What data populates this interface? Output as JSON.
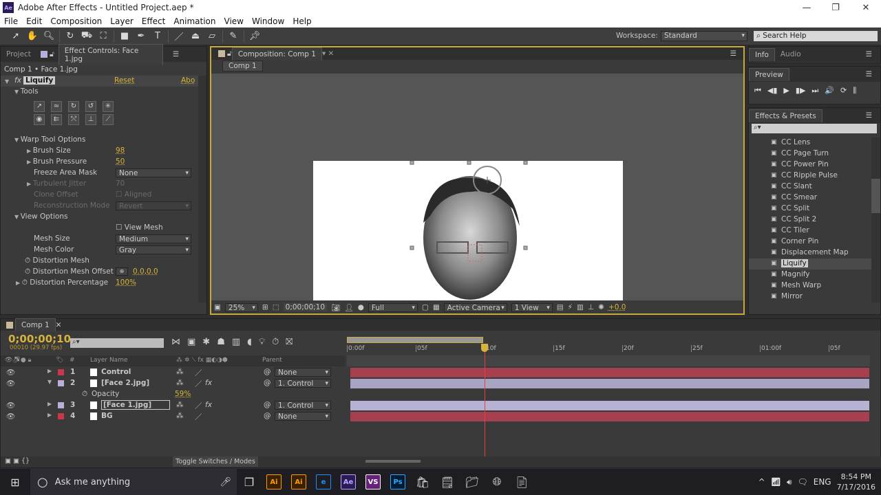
{
  "window": {
    "title": "Adobe After Effects - Untitled Project.aep *",
    "app_icon": "Ae",
    "minimize": "—",
    "restore": "❐",
    "close": "✕"
  },
  "menu": [
    "File",
    "Edit",
    "Composition",
    "Layer",
    "Effect",
    "Animation",
    "View",
    "Window",
    "Help"
  ],
  "toolbar": {
    "tools": [
      "selection-tool",
      "hand-tool",
      "zoom-tool",
      "rotation-tool",
      "camera-tool",
      "pan-behind-tool",
      "rectangle-tool",
      "pen-tool",
      "type-tool",
      "brush-tool",
      "clone-stamp-tool",
      "eraser-tool",
      "roto-brush-tool",
      "puppet-pin-tool"
    ],
    "workspace_label": "Workspace:",
    "workspace_value": "Standard",
    "search_help": "Search Help"
  },
  "effect_controls": {
    "tab_project": "Project",
    "tab_active": "Effect Controls: Face 1.jpg",
    "breadcrumb": "Comp 1 • Face 1.jpg",
    "effect_name": "Liquify",
    "reset": "Reset",
    "about": "Abo",
    "tools_label": "Tools",
    "warp_label": "Warp Tool Options",
    "brush_size_label": "Brush Size",
    "brush_size": "98",
    "brush_pressure_label": "Brush Pressure",
    "brush_pressure": "50",
    "freeze_label": "Freeze Area Mask",
    "freeze_value": "None",
    "turbulent_label": "Turbulent Jitter",
    "turbulent_value": "70",
    "clone_label": "Clone Offset",
    "aligned_label": "Aligned",
    "recon_label": "Reconstruction Mode",
    "recon_value": "Revert",
    "view_options_label": "View Options",
    "view_mesh_label": "View Mesh",
    "mesh_size_label": "Mesh Size",
    "mesh_size_value": "Medium",
    "mesh_color_label": "Mesh Color",
    "mesh_color_value": "Gray",
    "distortion_mesh_label": "Distortion Mesh",
    "offset_label": "Distortion Mesh Offset",
    "offset_value": "0.0,0.0",
    "percentage_label": "Distortion Percentage",
    "percentage_value": "100%"
  },
  "composition": {
    "tab": "Composition: Comp 1",
    "comp_button": "Comp 1",
    "zoom": "25%",
    "timecode": "0;00;00;10",
    "resolution": "Full",
    "camera": "Active Camera",
    "views": "1 View",
    "exposure": "+0.0"
  },
  "info": {
    "tab_info": "Info",
    "tab_audio": "Audio"
  },
  "preview": {
    "tab": "Preview",
    "controls": [
      "⏮",
      "◀▮",
      "▶",
      "▮▶",
      "⏭",
      "🔊",
      "⟳",
      "⫼"
    ]
  },
  "effects_presets": {
    "tab": "Effects & Presets",
    "items": [
      "CC Lens",
      "CC Page Turn",
      "CC Power Pin",
      "CC Ripple Pulse",
      "CC Slant",
      "CC Smear",
      "CC Split",
      "CC Split 2",
      "CC Tiler",
      "Corner Pin",
      "Displacement Map",
      "Liquify",
      "Magnify",
      "Mesh Warp",
      "Mirror"
    ],
    "selected": "Liquify"
  },
  "timeline": {
    "tab": "Comp 1",
    "timecode": "0;00;00;10",
    "frame_info": "00010 (29.97 fps)",
    "col_layer_name": "Layer Name",
    "col_parent": "Parent",
    "col_num": "#",
    "ruler": [
      "0:00f",
      "05f",
      "10f",
      "15f",
      "20f",
      "25f",
      "01:00f",
      "05f"
    ],
    "layers": [
      {
        "num": "1",
        "name": "Control",
        "color": "#c8374b",
        "parent": "None",
        "fx": false,
        "expanded": false,
        "bar_color": "#a6404f"
      },
      {
        "num": "2",
        "name": "[Face 2.jpg]",
        "color": "#b8b0d8",
        "parent": "1. Control",
        "fx": true,
        "expanded": true,
        "bar_color": "#a9a4c4"
      },
      {
        "num": "3",
        "name": "[Face 1.jpg]",
        "color": "#b8b0d8",
        "parent": "1. Control",
        "fx": true,
        "expanded": false,
        "bar_color": "#b7b1d4"
      },
      {
        "num": "4",
        "name": "BG",
        "color": "#c8374b",
        "parent": "None",
        "fx": false,
        "expanded": false,
        "bar_color": "#a6404f"
      }
    ],
    "opacity_label": "Opacity",
    "opacity_value": "59%",
    "toggle": "Toggle Switches / Modes",
    "playhead_frame": 10
  },
  "taskbar": {
    "search": "Ask me anything",
    "lang": "ENG",
    "time": "8:54 PM",
    "date": "7/17/2016",
    "apps": [
      {
        "label": "Ai",
        "bg": "#3a2200",
        "fg": "#ff9a00"
      },
      {
        "label": "Ai",
        "bg": "#3a2200",
        "fg": "#ff9a00"
      },
      {
        "label": "e",
        "bg": "transparent",
        "fg": "#1e90ff"
      },
      {
        "label": "Ae",
        "bg": "#2b1b57",
        "fg": "#b9a4ff"
      },
      {
        "label": "VS",
        "bg": "#68217a",
        "fg": "#fff"
      },
      {
        "label": "Ps",
        "bg": "#001d34",
        "fg": "#31a8ff"
      }
    ]
  }
}
